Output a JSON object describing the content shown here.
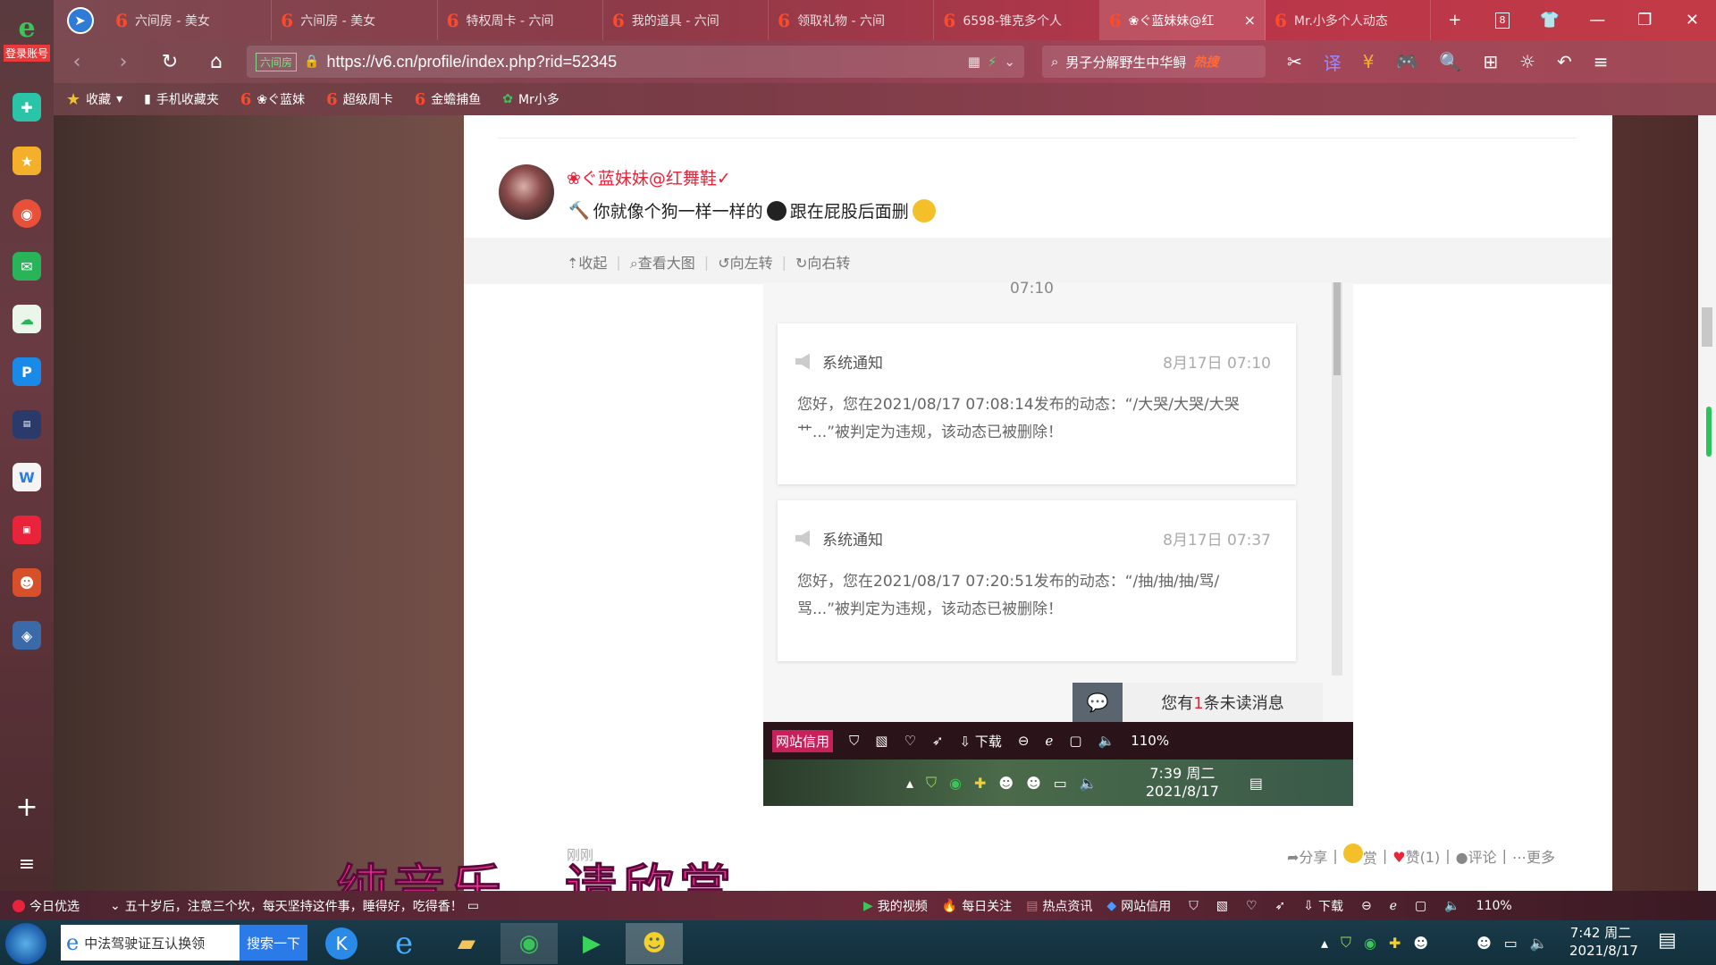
{
  "tabs": [
    {
      "label": "六间房 - 美女",
      "active": false
    },
    {
      "label": "六间房 - 美女",
      "active": false
    },
    {
      "label": "特权周卡 - 六间",
      "active": false
    },
    {
      "label": "我的道具 - 六间",
      "active": false
    },
    {
      "label": "领取礼物 - 六间",
      "active": false
    },
    {
      "label": "6598-锥克多个人",
      "active": false
    },
    {
      "label": "❀ぐ蓝妹妹@红",
      "active": true
    },
    {
      "label": "Mr.小多个人动态",
      "active": false
    }
  ],
  "tab_close": "×",
  "tab_count": "8",
  "address": {
    "site_badge": "六间房",
    "url": "https://v6.cn/profile/index.php?rid=52345"
  },
  "search": {
    "text": "男子分解野生中华鲟",
    "hot": "热搜"
  },
  "bookmarks": {
    "favorites": "收藏",
    "mobile": "手机收藏夹",
    "items": [
      "❀ぐ蓝妹",
      "超级周卡",
      "金蟾捕鱼",
      "Mr小多"
    ]
  },
  "sidebar": {
    "login": "登录账号"
  },
  "post": {
    "username": "❀ぐ蓝妹妹@红舞鞋✓",
    "text_before": "你就像个狗一样一样的",
    "text_after": "跟在屁股后面删",
    "time": "刚刚"
  },
  "image_toolbar": {
    "collapse": "收起",
    "view_large": "查看大图",
    "rotate_left": "向左转",
    "rotate_right": "向右转"
  },
  "embedded": {
    "top_time": "07:10",
    "notices": [
      {
        "title": "系统通知",
        "date": "8月17日 07:10",
        "body": "您好，您在2021/08/17 07:08:14发布的动态：“/大哭/大哭/大哭艹...”被判定为违规，该动态已被删除！"
      },
      {
        "title": "系统通知",
        "date": "8月17日 07:37",
        "body": "您好，您在2021/08/17 07:20:51发布的动态：“/抽/抽/抽/骂/骂...”被判定为违规，该动态已被删除！"
      }
    ],
    "unread_prefix": "您有",
    "unread_count": "1",
    "unread_suffix": "条未读消息",
    "status_site": "网站信用",
    "status_download": "下载",
    "status_zoom": "110%",
    "clock_time": "7:39 周二",
    "clock_date": "2021/8/17"
  },
  "post_actions": {
    "share": "分享",
    "reward": "赏",
    "like": "赞(1)",
    "comment": "评论",
    "more": "更多"
  },
  "subtitle": "纯音乐，请欣赏",
  "statusbar": {
    "today_pick": "今日优选",
    "news": "五十岁后，注意三个坎，每天坚持这件事，睡得好，吃得香！",
    "my_video": "我的视频",
    "daily_follow": "每日关注",
    "hot_news": "热点资讯",
    "site_credit": "网站信用",
    "download": "下载",
    "zoom": "110%"
  },
  "taskbar": {
    "search_text": "中法驾驶证互认换领",
    "search_button": "搜索一下",
    "clock_time": "7:42 周二",
    "clock_date": "2021/8/17"
  },
  "colors": {
    "accent_red": "#e8233a",
    "subtitle_pink": "#ff2c9a",
    "brand_green": "#3ac45a"
  }
}
